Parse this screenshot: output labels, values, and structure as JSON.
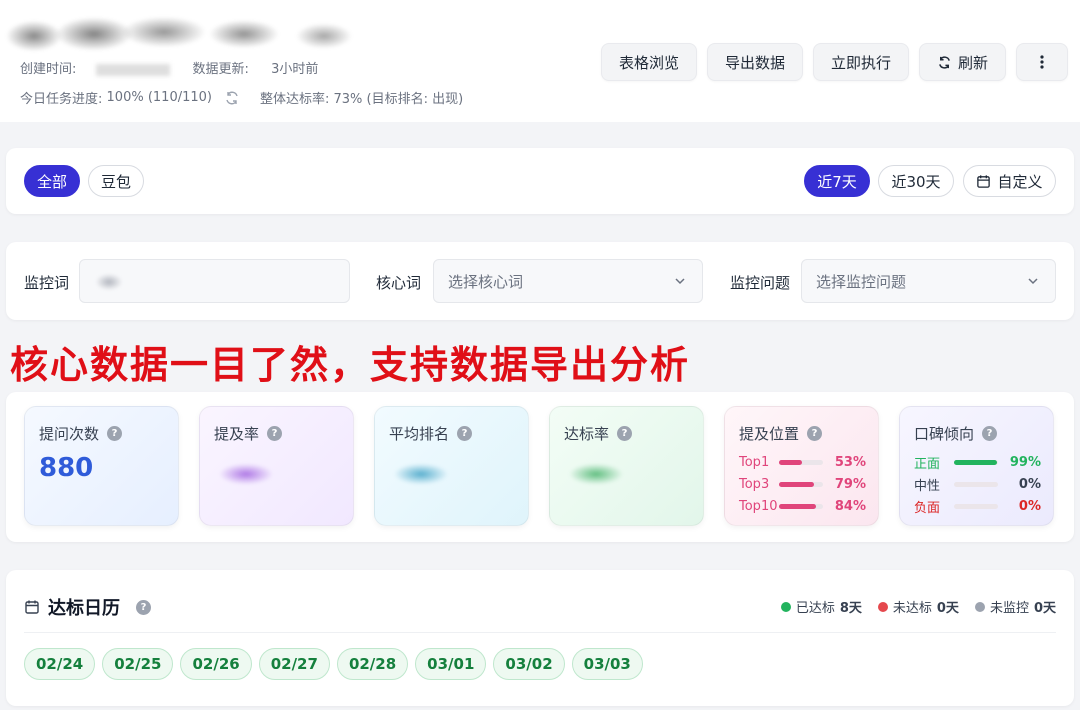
{
  "header": {
    "meta": {
      "created_label": "创建时间:",
      "updated_label": "数据更新:",
      "updated_value": "3小时前",
      "progress_label": "今日任务进度:",
      "progress_value": "100% (110/110)",
      "rate_label": "整体达标率:",
      "rate_value": "73% (目标排名: 出现)"
    },
    "buttons": {
      "table_view": "表格浏览",
      "export": "导出数据",
      "run_now": "立即执行",
      "refresh": "刷新"
    }
  },
  "filters": {
    "groups": [
      {
        "label": "全部",
        "active": true
      },
      {
        "label": "豆包",
        "active": false
      }
    ],
    "ranges": [
      {
        "label": "近7天",
        "active": true
      },
      {
        "label": "近30天",
        "active": false
      },
      {
        "label": "自定义",
        "active": false
      }
    ]
  },
  "search": {
    "keyword_label": "监控词",
    "core_label": "核心词",
    "core_placeholder": "选择核心词",
    "question_label": "监控问题",
    "question_placeholder": "选择监控问题"
  },
  "banner": "核心数据一目了然，支持数据导出分析",
  "stats": {
    "questions": {
      "title": "提问次数",
      "value": "880"
    },
    "mention_rate": {
      "title": "提及率"
    },
    "avg_rank": {
      "title": "平均排名"
    },
    "hit_rate": {
      "title": "达标率"
    },
    "position": {
      "title": "提及位置",
      "rows": [
        {
          "label": "Top1",
          "value": "53%",
          "fraction": 0.53
        },
        {
          "label": "Top3",
          "value": "79%",
          "fraction": 0.79
        },
        {
          "label": "Top10",
          "value": "84%",
          "fraction": 0.84
        }
      ]
    },
    "sentiment": {
      "title": "口碑倾向",
      "rows": [
        {
          "label": "正面",
          "value": "99%",
          "fraction": 0.99
        },
        {
          "label": "中性",
          "value": "0%",
          "fraction": 0
        },
        {
          "label": "负面",
          "value": "0%",
          "fraction": 0
        }
      ]
    }
  },
  "calendar": {
    "title": "达标日历",
    "legend": [
      {
        "label": "已达标",
        "count": "8天",
        "color": "#22b35e"
      },
      {
        "label": "未达标",
        "count": "0天",
        "color": "#e5484d"
      },
      {
        "label": "未监控",
        "count": "0天",
        "color": "#9ca3af"
      }
    ],
    "days": [
      "02/24",
      "02/25",
      "02/26",
      "02/27",
      "02/28",
      "03/01",
      "03/02",
      "03/03"
    ]
  },
  "colors": {
    "accent": "#3730d4",
    "number": "#2f5bd9",
    "banner": "#e00f17",
    "position_pink": "#e0457b",
    "sentiment_green": "#22b35e",
    "negative_red": "#dc2626"
  }
}
